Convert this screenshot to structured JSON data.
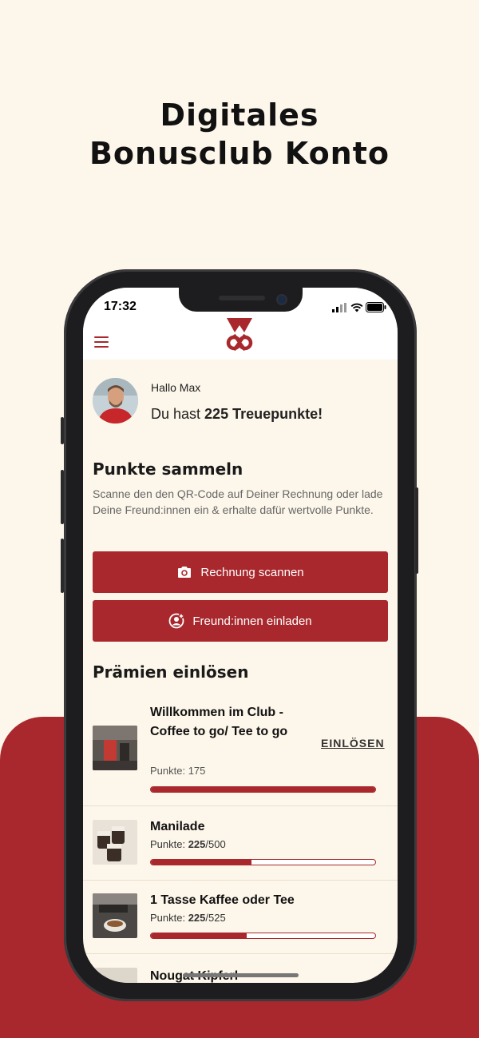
{
  "promo": {
    "headline_line1": "Digitales",
    "headline_line2": "Bonusclub Konto"
  },
  "status_bar": {
    "time": "17:32"
  },
  "colors": {
    "brand_red": "#a8282d",
    "background": "#fdf6ea"
  },
  "app_bar": {
    "menu_icon": "hamburger-menu-icon",
    "logo": "brand-logo"
  },
  "profile": {
    "greeting": "Hallo Max",
    "points_prefix": "Du hast ",
    "points_value": "225 Treuepunkte!"
  },
  "collect": {
    "title": "Punkte sammeln",
    "description": "Scanne den den QR-Code auf Deiner Rechnung oder lade Deine Freund:innen ein & erhalte dafür wertvolle Punkte.",
    "scan_button": "Rechnung scannen",
    "scan_icon": "camera-icon",
    "invite_button": "Freund:innen einladen",
    "invite_icon": "add-user-icon"
  },
  "rewards": {
    "title": "Prämien einlösen",
    "redeem_label": "EINLÖSEN",
    "items": [
      {
        "title": "Willkommen im Club - Coffee to go/ Tee to go",
        "points_label": "Punkte: 175",
        "progress": 1.0
      },
      {
        "title": "Manilade",
        "points_prefix": "Punkte: ",
        "points_current": "225",
        "points_total": "/500",
        "progress": 0.45
      },
      {
        "title": "1 Tasse Kaffee oder Tee",
        "points_prefix": "Punkte: ",
        "points_current": "225",
        "points_total": "/525",
        "progress": 0.4286
      },
      {
        "title": "Nougat Kipferl"
      }
    ]
  }
}
